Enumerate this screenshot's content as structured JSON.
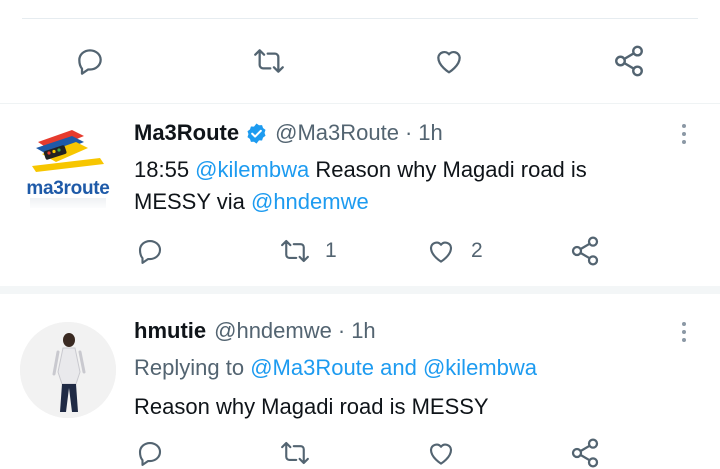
{
  "top_actions": {
    "reply_icon": "speech-bubble",
    "retweet_icon": "retweet-arrows",
    "like_icon": "heart",
    "share_icon": "share-nodes"
  },
  "tweets": [
    {
      "display_name": "Ma3Route",
      "verified": true,
      "handle": "@Ma3Route",
      "sep": "·",
      "time": "1h",
      "logo_text": "ma3route",
      "text_prefix": "18:55 ",
      "mention1": "@kilembwa",
      "text_mid": " Reason why Magadi road is",
      "text_line2": "MESSY via ",
      "mention2": "@hndemwe",
      "retweets": "1",
      "likes": "2"
    },
    {
      "display_name": "hmutie",
      "handle": "@hndemwe",
      "sep": "·",
      "time": "1h",
      "replying_to_label": "Replying to ",
      "replying_to_users": "@Ma3Route and @kilembwa",
      "text": "Reason why Magadi road is MESSY"
    }
  ],
  "colors": {
    "accent": "#1d9bf0",
    "icon": "#536471",
    "verified": "#1d9bf0"
  }
}
